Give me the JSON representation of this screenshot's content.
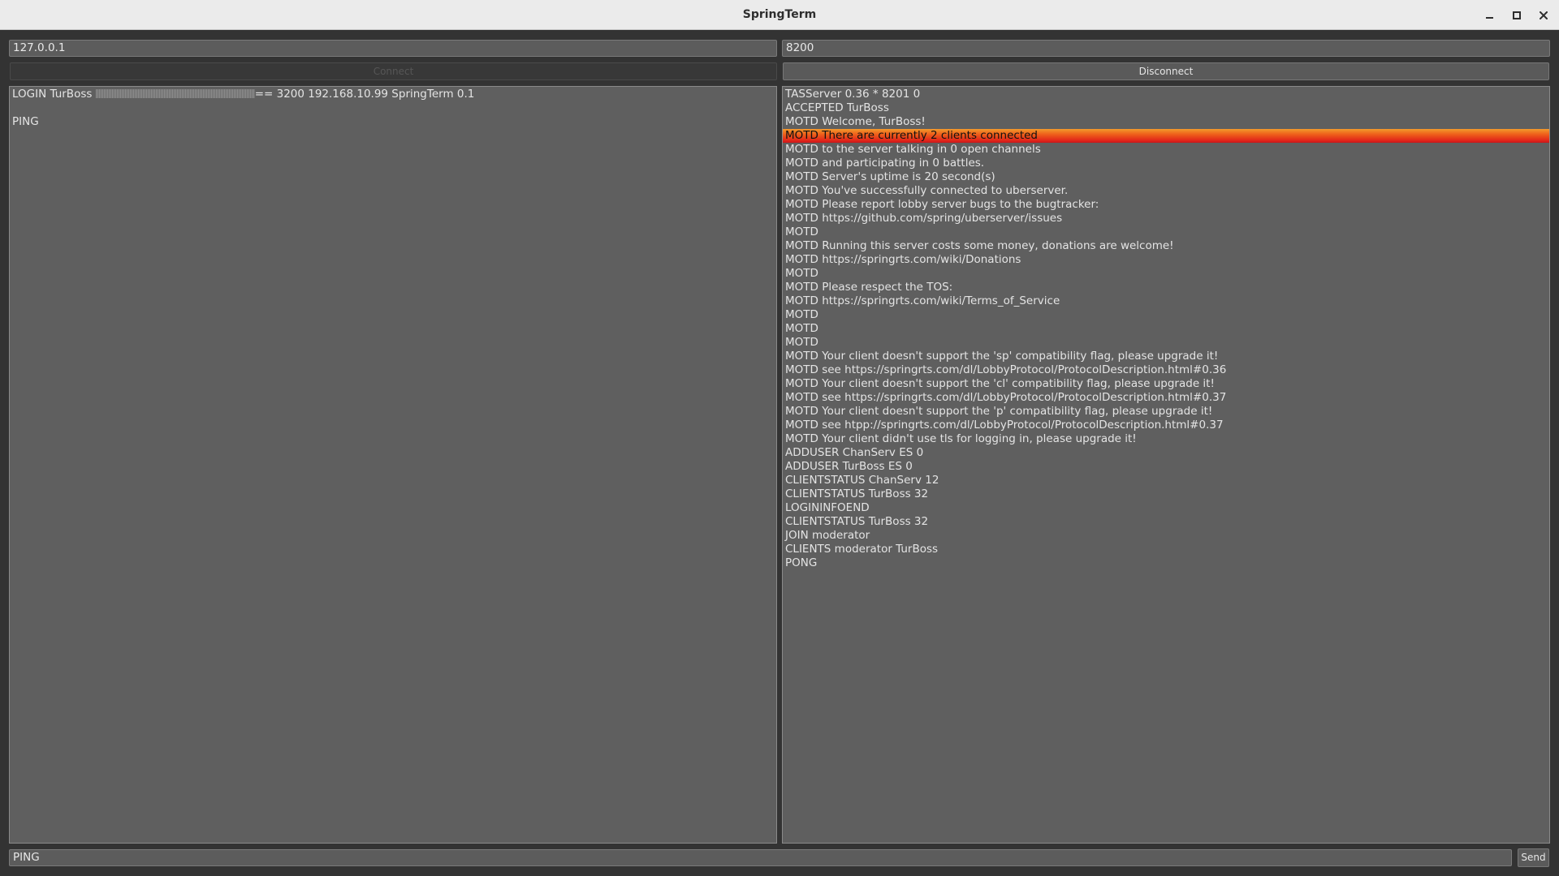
{
  "window": {
    "title": "SpringTerm"
  },
  "connection": {
    "host": "127.0.0.1",
    "port": "8200",
    "connect_label": "Connect",
    "disconnect_label": "Disconnect"
  },
  "sent_log": {
    "login_prefix": "LOGIN TurBoss ",
    "login_suffix": "== 3200 192.168.10.99 SpringTerm 0.1",
    "lines": [
      "",
      "PING"
    ]
  },
  "received_log": {
    "highlighted_index": 3,
    "lines": [
      "TASServer 0.36 * 8201 0",
      "ACCEPTED TurBoss",
      "MOTD Welcome, TurBoss!",
      "MOTD There are currently 2 clients connected",
      "MOTD to the server talking in 0 open channels",
      "MOTD and participating in 0 battles.",
      "MOTD Server's uptime is 20 second(s)",
      "MOTD You've successfully connected to uberserver.",
      "MOTD Please report lobby server bugs to the bugtracker:",
      "MOTD https://github.com/spring/uberserver/issues",
      "MOTD",
      "MOTD Running this server costs some money, donations are welcome!",
      "MOTD https://springrts.com/wiki/Donations",
      "MOTD",
      "MOTD Please respect the TOS:",
      "MOTD https://springrts.com/wiki/Terms_of_Service",
      "MOTD",
      "MOTD",
      "MOTD",
      "MOTD Your client doesn't support the 'sp' compatibility flag, please upgrade it!",
      "MOTD see https://springrts.com/dl/LobbyProtocol/ProtocolDescription.html#0.36",
      "MOTD Your client doesn't support the 'cl' compatibility flag, please upgrade it!",
      "MOTD see https://springrts.com/dl/LobbyProtocol/ProtocolDescription.html#0.37",
      "MOTD Your client doesn't support the 'p' compatibility flag, please upgrade it!",
      "MOTD see htpp://springrts.com/dl/LobbyProtocol/ProtocolDescription.html#0.37",
      "MOTD Your client didn't use tls for logging in, please upgrade it!",
      "ADDUSER ChanServ ES 0",
      "ADDUSER TurBoss ES 0",
      "CLIENTSTATUS ChanServ 12",
      "CLIENTSTATUS TurBoss 32",
      "LOGININFOEND",
      "CLIENTSTATUS TurBoss 32",
      "JOIN moderator",
      "CLIENTS moderator TurBoss",
      "PONG"
    ]
  },
  "command": {
    "value": "PING",
    "send_label": "Send"
  },
  "colors": {
    "highlight_top": "#f39a2c",
    "highlight_bottom": "#c8161a",
    "panel_bg": "#5f5f5f"
  }
}
